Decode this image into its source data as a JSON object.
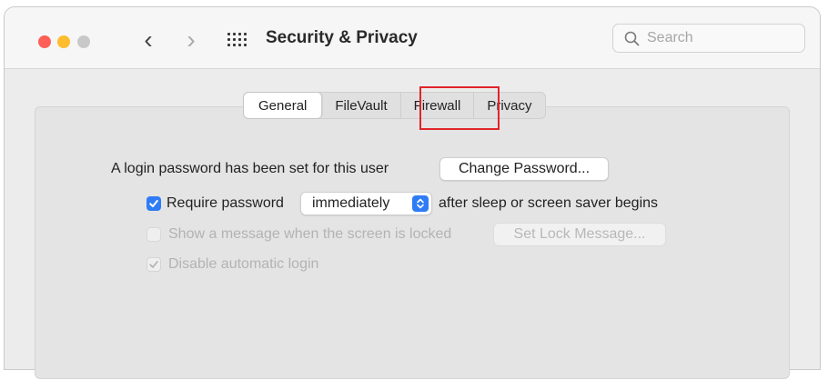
{
  "window": {
    "title": "Security & Privacy",
    "traffic_lights": {
      "close_color": "#fe5f57",
      "minimize_color": "#febc2e",
      "zoom_color": "#c8c8c8"
    },
    "nav": {
      "back_icon": "‹",
      "forward_icon": "›",
      "show_all_icon": "grid-icon"
    },
    "search": {
      "placeholder": "Search",
      "value": ""
    }
  },
  "tabs": [
    {
      "label": "General",
      "selected": true
    },
    {
      "label": "FileVault",
      "selected": false
    },
    {
      "label": "Firewall",
      "selected": false,
      "highlighted": true
    },
    {
      "label": "Privacy",
      "selected": false
    }
  ],
  "highlight_color": "#e0242a",
  "general": {
    "login_password_text": "A login password has been set for this user",
    "change_password_button": "Change Password...",
    "require_password": {
      "checked": true,
      "label": "Require password",
      "select_value": "immediately",
      "suffix": "after sleep or screen saver begins"
    },
    "show_message": {
      "checked": false,
      "enabled": false,
      "label": "Show a message when the screen is locked",
      "button": "Set Lock Message..."
    },
    "disable_auto_login": {
      "checked": true,
      "enabled": false,
      "label": "Disable automatic login"
    }
  }
}
